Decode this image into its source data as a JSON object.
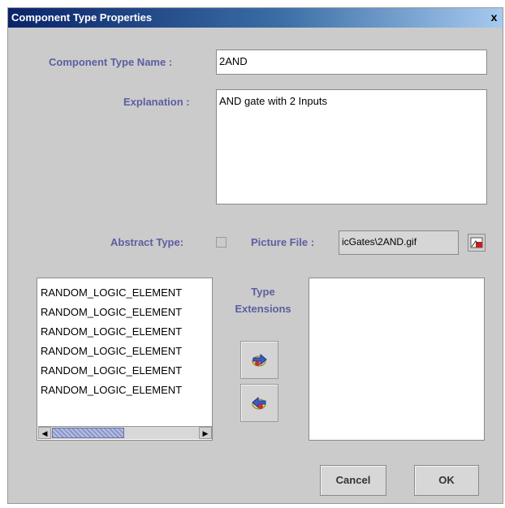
{
  "window": {
    "title": "Component Type Properties",
    "close_glyph": "x"
  },
  "fields": {
    "name_label": "Component Type Name :",
    "name_value": "2AND",
    "explanation_label": "Explanation :",
    "explanation_value": "AND gate with 2 Inputs",
    "abstract_label": "Abstract Type:",
    "abstract_checked": false,
    "picture_label": "Picture File :",
    "picture_value": "icGates\\2AND.gif"
  },
  "type_list": {
    "items": [
      "RANDOM_LOGIC_ELEMENT",
      "RANDOM_LOGIC_ELEMENT",
      "RANDOM_LOGIC_ELEMENT",
      "RANDOM_LOGIC_ELEMENT",
      "RANDOM_LOGIC_ELEMENT",
      "RANDOM_LOGIC_ELEMENT"
    ]
  },
  "extensions": {
    "label_line1": "Type",
    "label_line2": "Extensions",
    "add_icon": "arrow-right-icon",
    "remove_icon": "arrow-left-icon"
  },
  "buttons": {
    "cancel": "Cancel",
    "ok": "OK"
  }
}
